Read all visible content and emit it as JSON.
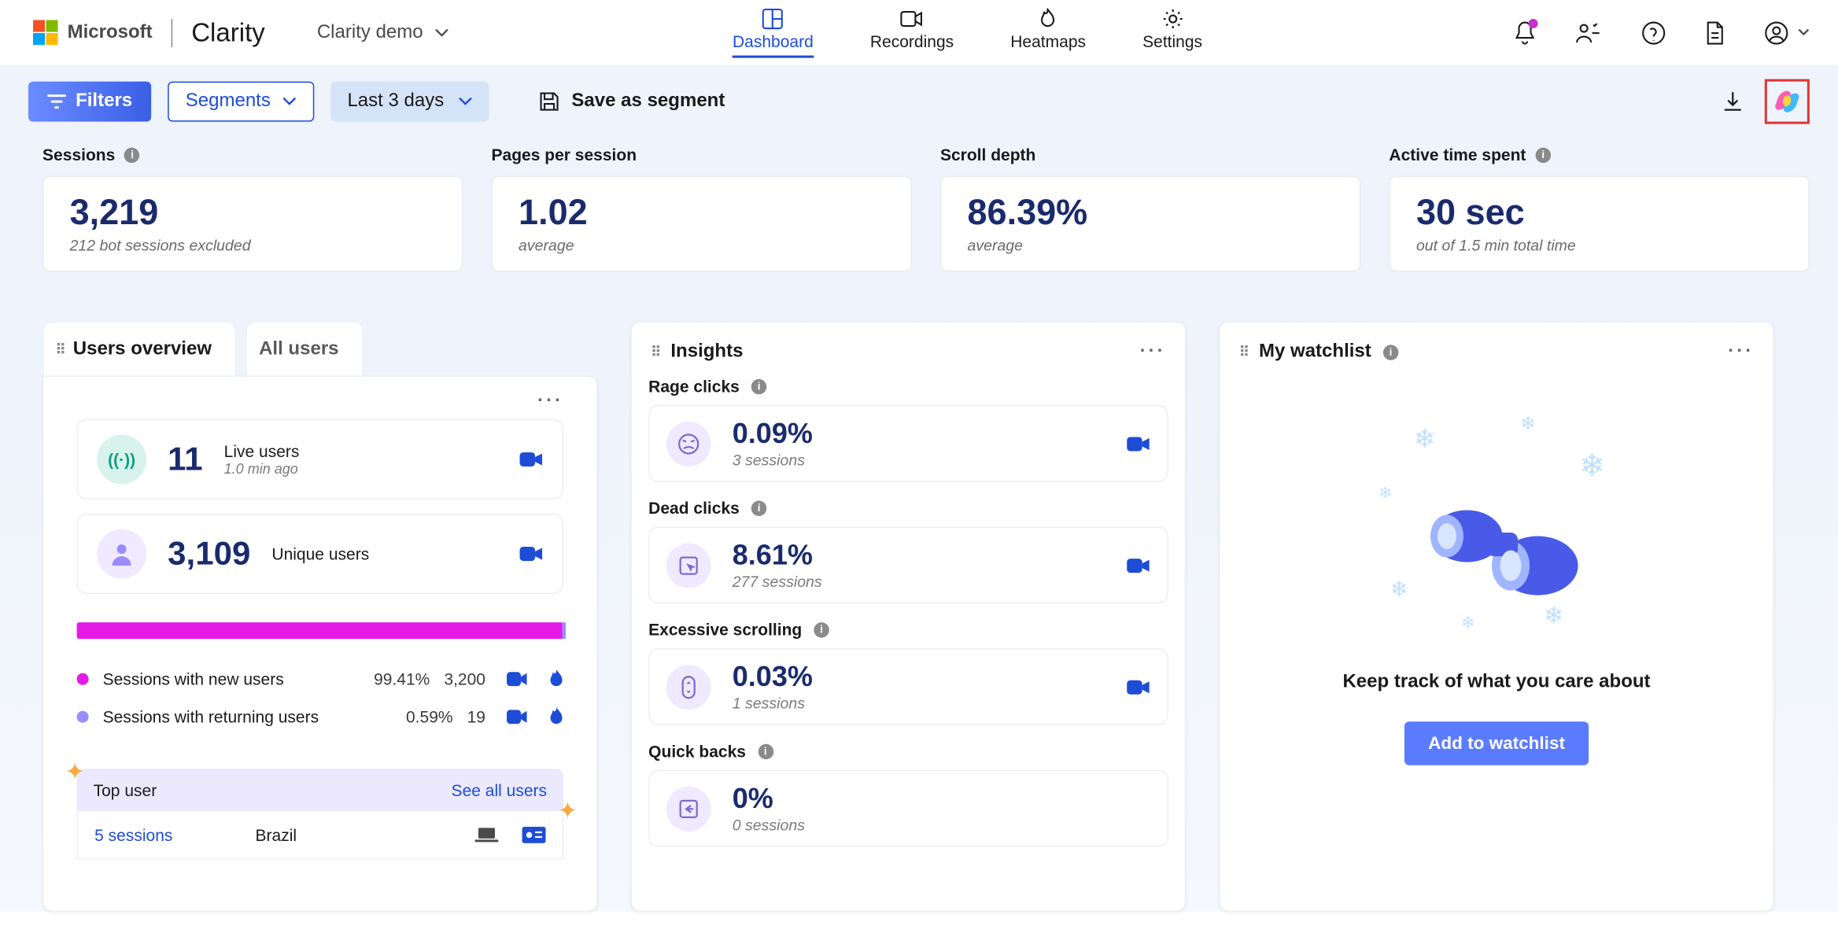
{
  "header": {
    "ms": "Microsoft",
    "brand": "Clarity",
    "demo": "Clarity demo",
    "nav": [
      "Dashboard",
      "Recordings",
      "Heatmaps",
      "Settings"
    ]
  },
  "filterbar": {
    "filters": "Filters",
    "segments": "Segments",
    "days": "Last 3 days",
    "save": "Save as segment"
  },
  "kpi": {
    "sessions": {
      "label": "Sessions",
      "value": "3,219",
      "sub": "212 bot sessions excluded"
    },
    "pps": {
      "label": "Pages per session",
      "value": "1.02",
      "sub": "average"
    },
    "scroll": {
      "label": "Scroll depth",
      "value": "86.39%",
      "sub": "average"
    },
    "active": {
      "label": "Active time spent",
      "value": "30 sec",
      "sub": "out of 1.5 min total time"
    }
  },
  "users": {
    "tab_overview": "Users overview",
    "tab_all": "All users",
    "live": {
      "num": "11",
      "label": "Live users",
      "sub": "1.0 min ago"
    },
    "unique": {
      "num": "3,109",
      "label": "Unique users"
    },
    "legend_new": {
      "label": "Sessions with new users",
      "pct": "99.41%",
      "n": "3,200"
    },
    "legend_ret": {
      "label": "Sessions with returning users",
      "pct": "0.59%",
      "n": "19"
    },
    "topuser": {
      "label": "Top user",
      "see": "See all users",
      "sessions": "5 sessions",
      "country": "Brazil"
    }
  },
  "insights": {
    "title": "Insights",
    "rage": {
      "label": "Rage clicks",
      "val": "0.09%",
      "sub": "3 sessions"
    },
    "dead": {
      "label": "Dead clicks",
      "val": "8.61%",
      "sub": "277 sessions"
    },
    "exscroll": {
      "label": "Excessive scrolling",
      "val": "0.03%",
      "sub": "1 sessions"
    },
    "qback": {
      "label": "Quick backs",
      "val": "0%",
      "sub": "0 sessions"
    }
  },
  "watch": {
    "title": "My watchlist",
    "msg": "Keep track of what you care about",
    "btn": "Add to watchlist"
  }
}
